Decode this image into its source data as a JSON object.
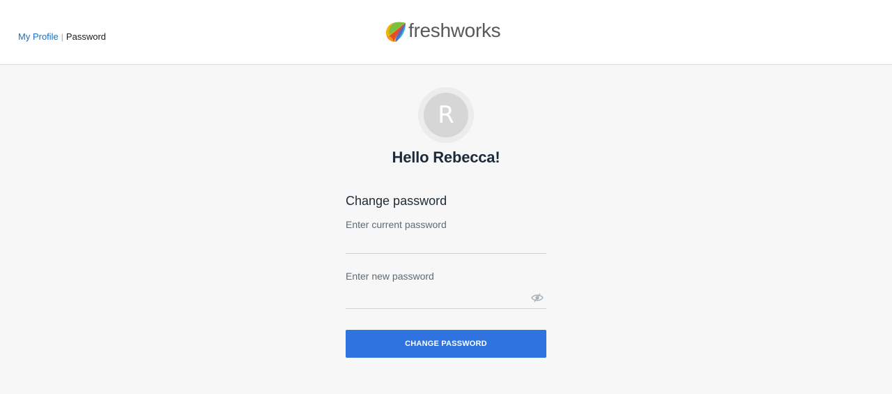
{
  "breadcrumb": {
    "items": [
      {
        "label": "My Profile"
      },
      {
        "label": "Password"
      }
    ],
    "separator": "|"
  },
  "brand": {
    "name": "freshworks",
    "logo_icon": "freshworks-logo-icon"
  },
  "profile": {
    "avatar_initial": "R",
    "greeting": "Hello Rebecca!"
  },
  "form": {
    "title": "Change password",
    "current_password": {
      "label": "Enter current password",
      "value": ""
    },
    "new_password": {
      "label": "Enter new password",
      "value": "",
      "toggle_icon": "eye-off-icon"
    },
    "submit_label": "CHANGE PASSWORD"
  },
  "colors": {
    "accent": "#2f73e0",
    "link": "#1f6fbf",
    "heading": "#1c2b3a",
    "background": "#f7f7f7"
  }
}
